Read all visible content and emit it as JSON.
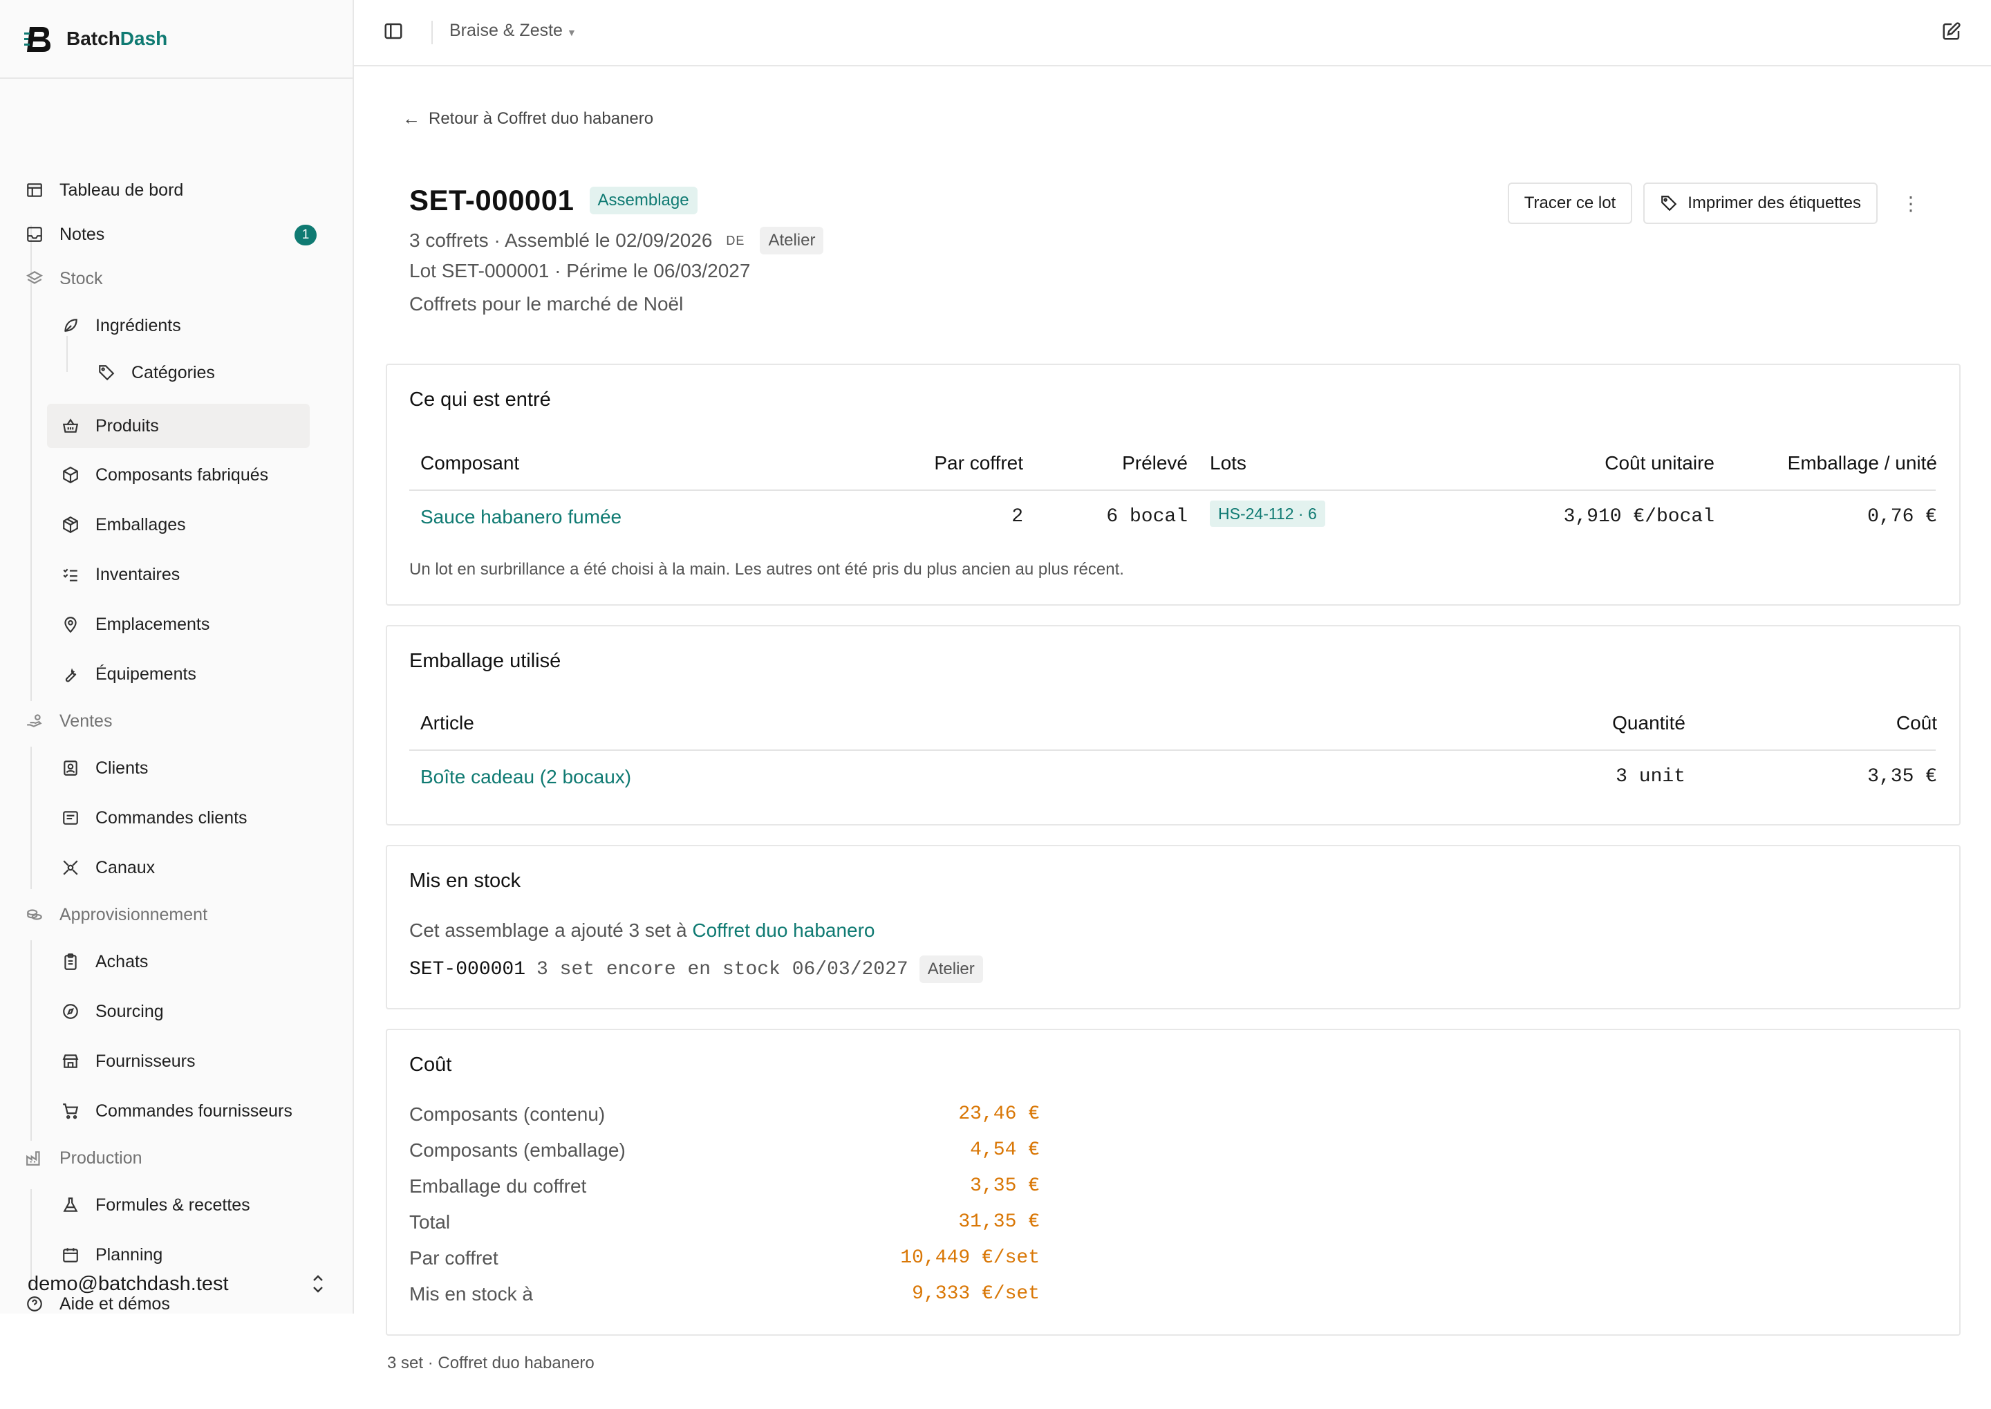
{
  "brand": {
    "name_part1": "Batch",
    "name_part2": "Dash",
    "accent": "#0f7a72"
  },
  "sidebar": {
    "items": [
      {
        "label": "Tableau de bord",
        "icon": "layout-icon"
      },
      {
        "label": "Notes",
        "icon": "inbox-icon",
        "badge": "1"
      },
      {
        "label": "Stock",
        "icon": "layers-icon"
      },
      {
        "label": "Ingrédients",
        "icon": "leaf-icon"
      },
      {
        "label": "Catégories",
        "icon": "tag-icon"
      },
      {
        "label": "Produits",
        "icon": "basket-icon"
      },
      {
        "label": "Composants fabriqués",
        "icon": "box-icon"
      },
      {
        "label": "Emballages",
        "icon": "package-icon"
      },
      {
        "label": "Inventaires",
        "icon": "checklist-icon"
      },
      {
        "label": "Emplacements",
        "icon": "map-pin-icon"
      },
      {
        "label": "Équipements",
        "icon": "wrench-icon"
      },
      {
        "label": "Ventes",
        "icon": "hand-coins-icon"
      },
      {
        "label": "Clients",
        "icon": "contact-icon"
      },
      {
        "label": "Commandes clients",
        "icon": "receipt-icon"
      },
      {
        "label": "Canaux",
        "icon": "network-icon"
      },
      {
        "label": "Approvisionnement",
        "icon": "coins-icon"
      },
      {
        "label": "Achats",
        "icon": "clipboard-icon"
      },
      {
        "label": "Sourcing",
        "icon": "compass-icon"
      },
      {
        "label": "Fournisseurs",
        "icon": "store-icon"
      },
      {
        "label": "Commandes fournisseurs",
        "icon": "cart-icon"
      },
      {
        "label": "Production",
        "icon": "factory-icon"
      },
      {
        "label": "Formules & recettes",
        "icon": "flask-icon"
      },
      {
        "label": "Planning",
        "icon": "calendar-icon"
      },
      {
        "label": "Aide et démos",
        "icon": "help-icon"
      }
    ],
    "user_email": "demo@batchdash.test"
  },
  "topbar": {
    "organization": "Braise & Zeste"
  },
  "page": {
    "back_label": "Retour à Coffret duo habanero",
    "title": "SET-000001",
    "type_badge": "Assemblage",
    "meta_count": "3 coffrets",
    "meta_assembled": "· Assemblé le 02/09/2026",
    "meta_lang": "DE",
    "meta_location": "Atelier",
    "meta_lot": "Lot SET-000001 · Périme le 06/03/2027",
    "meta_note": "Coffrets pour le marché de Noël",
    "actions": {
      "trace": "Tracer ce lot",
      "print": "Imprimer des étiquettes"
    }
  },
  "inputs_section": {
    "title": "Ce qui est entré",
    "headers": [
      "Composant",
      "Par coffret",
      "Prélevé",
      "Lots",
      "Coût unitaire",
      "Emballage / unité"
    ],
    "rows": [
      {
        "component": "Sauce habanero fumée",
        "per_box": "2",
        "taken": "6 bocal",
        "lot": "HS-24-112 · 6",
        "unit_cost": "3,910 €/bocal",
        "packaging_unit": "0,76 €"
      }
    ],
    "note": "Un lot en surbrillance a été choisi à la main. Les autres ont été pris du plus ancien au plus récent."
  },
  "packaging_section": {
    "title": "Emballage utilisé",
    "headers": [
      "Article",
      "Quantité",
      "Coût"
    ],
    "rows": [
      {
        "article": "Boîte cadeau (2 bocaux)",
        "quantity": "3 unit",
        "cost": "3,35 €"
      }
    ]
  },
  "stock_section": {
    "title": "Mis en stock",
    "sentence_prefix": "Cet assemblage a ajouté 3 set à",
    "product_link": "Coffret duo habanero",
    "lot_code": "SET-000001",
    "lot_details": "3 set encore en stock 06/03/2027",
    "location": "Atelier"
  },
  "cost_section": {
    "title": "Coût",
    "rows": [
      {
        "label": "Composants (contenu)",
        "value": "23,46 €"
      },
      {
        "label": "Composants (emballage)",
        "value": "4,54 €"
      },
      {
        "label": "Emballage du coffret",
        "value": "3,35 €"
      },
      {
        "label": "Total",
        "value": "31,35 €"
      },
      {
        "label": "Par coffret",
        "value": "10,449 €/set"
      },
      {
        "label": "Mis en stock à",
        "value": "9,333 €/set"
      }
    ],
    "value_color": "#d97706"
  },
  "footer_note": "3 set · Coffret duo habanero"
}
